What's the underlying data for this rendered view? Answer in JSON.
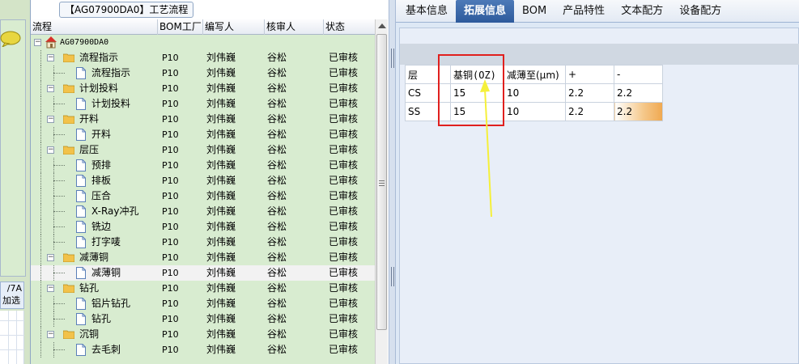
{
  "panel_title": "【AG07900DA0】工艺流程",
  "columns": {
    "flow": "流程",
    "bom": "BOM工厂",
    "writer": "编写人",
    "reviewer": "核审人",
    "status": "状态"
  },
  "tree_rows": [
    {
      "label": "AG07900DA0",
      "level": 0,
      "type": "root",
      "bom": "",
      "writer": "",
      "reviewer": "",
      "status": ""
    },
    {
      "label": "流程指示",
      "level": 1,
      "type": "folder",
      "bom": "P10",
      "writer": "刘伟巍",
      "reviewer": "谷松",
      "status": "已审核"
    },
    {
      "label": "流程指示",
      "level": 2,
      "type": "doc",
      "bom": "P10",
      "writer": "刘伟巍",
      "reviewer": "谷松",
      "status": "已审核"
    },
    {
      "label": "计划投料",
      "level": 1,
      "type": "folder",
      "bom": "P10",
      "writer": "刘伟巍",
      "reviewer": "谷松",
      "status": "已审核"
    },
    {
      "label": "计划投料",
      "level": 2,
      "type": "doc",
      "bom": "P10",
      "writer": "刘伟巍",
      "reviewer": "谷松",
      "status": "已审核"
    },
    {
      "label": "开料",
      "level": 1,
      "type": "folder",
      "bom": "P10",
      "writer": "刘伟巍",
      "reviewer": "谷松",
      "status": "已审核"
    },
    {
      "label": "开料",
      "level": 2,
      "type": "doc",
      "bom": "P10",
      "writer": "刘伟巍",
      "reviewer": "谷松",
      "status": "已审核"
    },
    {
      "label": "层压",
      "level": 1,
      "type": "folder",
      "bom": "P10",
      "writer": "刘伟巍",
      "reviewer": "谷松",
      "status": "已审核"
    },
    {
      "label": "预排",
      "level": 2,
      "type": "doc",
      "bom": "P10",
      "writer": "刘伟巍",
      "reviewer": "谷松",
      "status": "已审核"
    },
    {
      "label": "排板",
      "level": 2,
      "type": "doc",
      "bom": "P10",
      "writer": "刘伟巍",
      "reviewer": "谷松",
      "status": "已审核"
    },
    {
      "label": "压合",
      "level": 2,
      "type": "doc",
      "bom": "P10",
      "writer": "刘伟巍",
      "reviewer": "谷松",
      "status": "已审核"
    },
    {
      "label": "X-Ray冲孔",
      "level": 2,
      "type": "doc",
      "bom": "P10",
      "writer": "刘伟巍",
      "reviewer": "谷松",
      "status": "已审核"
    },
    {
      "label": "铣边",
      "level": 2,
      "type": "doc",
      "bom": "P10",
      "writer": "刘伟巍",
      "reviewer": "谷松",
      "status": "已审核"
    },
    {
      "label": "打字唛",
      "level": 2,
      "type": "doc",
      "bom": "P10",
      "writer": "刘伟巍",
      "reviewer": "谷松",
      "status": "已审核"
    },
    {
      "label": "减薄铜",
      "level": 1,
      "type": "folder",
      "bom": "P10",
      "writer": "刘伟巍",
      "reviewer": "谷松",
      "status": "已审核"
    },
    {
      "label": "减薄铜",
      "level": 2,
      "type": "doc",
      "bom": "P10",
      "writer": "刘伟巍",
      "reviewer": "谷松",
      "status": "已审核",
      "selected": true
    },
    {
      "label": "钻孔",
      "level": 1,
      "type": "folder",
      "bom": "P10",
      "writer": "刘伟巍",
      "reviewer": "谷松",
      "status": "已审核"
    },
    {
      "label": "铝片钻孔",
      "level": 2,
      "type": "doc",
      "bom": "P10",
      "writer": "刘伟巍",
      "reviewer": "谷松",
      "status": "已审核"
    },
    {
      "label": "钻孔",
      "level": 2,
      "type": "doc",
      "bom": "P10",
      "writer": "刘伟巍",
      "reviewer": "谷松",
      "status": "已审核"
    },
    {
      "label": "沉铜",
      "level": 1,
      "type": "folder",
      "bom": "P10",
      "writer": "刘伟巍",
      "reviewer": "谷松",
      "status": "已审核"
    },
    {
      "label": "去毛刺",
      "level": 2,
      "type": "doc",
      "bom": "P10",
      "writer": "刘伟巍",
      "reviewer": "谷松",
      "status": "已审核"
    }
  ],
  "tabs": [
    {
      "label": "基本信息",
      "active": false
    },
    {
      "label": "拓展信息",
      "active": true
    },
    {
      "label": "BOM",
      "active": false
    },
    {
      "label": "产品特性",
      "active": false
    },
    {
      "label": "文本配方",
      "active": false
    },
    {
      "label": "设备配方",
      "active": false
    }
  ],
  "ext_table": {
    "headers": [
      "层",
      "基铜(OZ)",
      "减薄至(μm)",
      "+",
      "-"
    ],
    "rows": [
      [
        "CS",
        "15",
        "10",
        "2.2",
        "2.2"
      ],
      [
        "SS",
        "15",
        "10",
        "2.2",
        "2.2"
      ]
    ]
  },
  "left_strip": {
    "line1": "/7A",
    "line2": "加选"
  },
  "colors": {
    "tree_bg": "#d8ecd0",
    "tab_active": "#3a68a8",
    "highlight_box": "#e0201e",
    "annotation_arrow": "#f5f03a",
    "header_orange": "#f5b766"
  },
  "icons": {
    "root": "house-icon",
    "folder": "folder-icon",
    "doc": "document-icon",
    "chat": "speech-bubble-icon"
  }
}
